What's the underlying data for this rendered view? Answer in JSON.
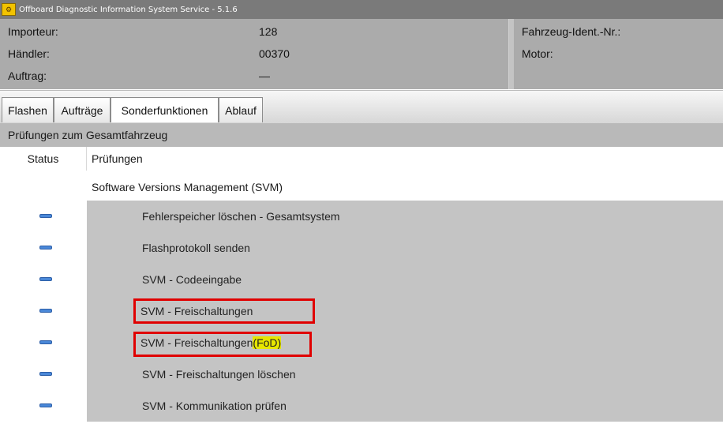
{
  "window": {
    "title": "Offboard Diagnostic Information System Service - 5.1.6",
    "icon": "car-engine-icon"
  },
  "info_left": [
    {
      "label": "Importeur:",
      "value": "128"
    },
    {
      "label": "Händler:",
      "value": "00370"
    },
    {
      "label": "Auftrag:",
      "value": "—"
    }
  ],
  "info_right": [
    {
      "label": "Fahrzeug-Ident.-Nr.:"
    },
    {
      "label": "Motor:"
    }
  ],
  "tabs": [
    {
      "label": "Flashen",
      "active": false
    },
    {
      "label": "Aufträge",
      "active": false
    },
    {
      "label": "Sonderfunktionen",
      "active": true
    },
    {
      "label": "Ablauf",
      "active": false
    }
  ],
  "section": {
    "title": "Prüfungen zum Gesamtfahrzeug"
  },
  "columns": {
    "status": "Status",
    "pruefungen": "Prüfungen"
  },
  "group": {
    "title": "Software Versions Management (SVM)"
  },
  "items": [
    {
      "label": "Fehlerspeicher löschen - Gesamtsystem",
      "status": "blue-dash",
      "highlighted": false
    },
    {
      "label": "Flashprotokoll senden",
      "status": "blue-dash",
      "highlighted": false
    },
    {
      "label": "SVM - Codeeingabe",
      "status": "blue-dash",
      "highlighted": false
    },
    {
      "label": "SVM - Freischaltungen",
      "status": "blue-dash",
      "highlighted": true
    },
    {
      "label": "SVM - Freischaltungen ",
      "label_suffix": "(FoD)",
      "status": "blue-dash",
      "highlighted": true
    },
    {
      "label": "SVM - Freischaltungen löschen",
      "status": "blue-dash",
      "highlighted": false
    },
    {
      "label": "SVM - Kommunikation prüfen",
      "status": "blue-dash",
      "highlighted": false
    }
  ],
  "colors": {
    "highlight_border": "#e00000",
    "fod_highlight": "#e6e600",
    "status_mark": "#4a88d8"
  }
}
